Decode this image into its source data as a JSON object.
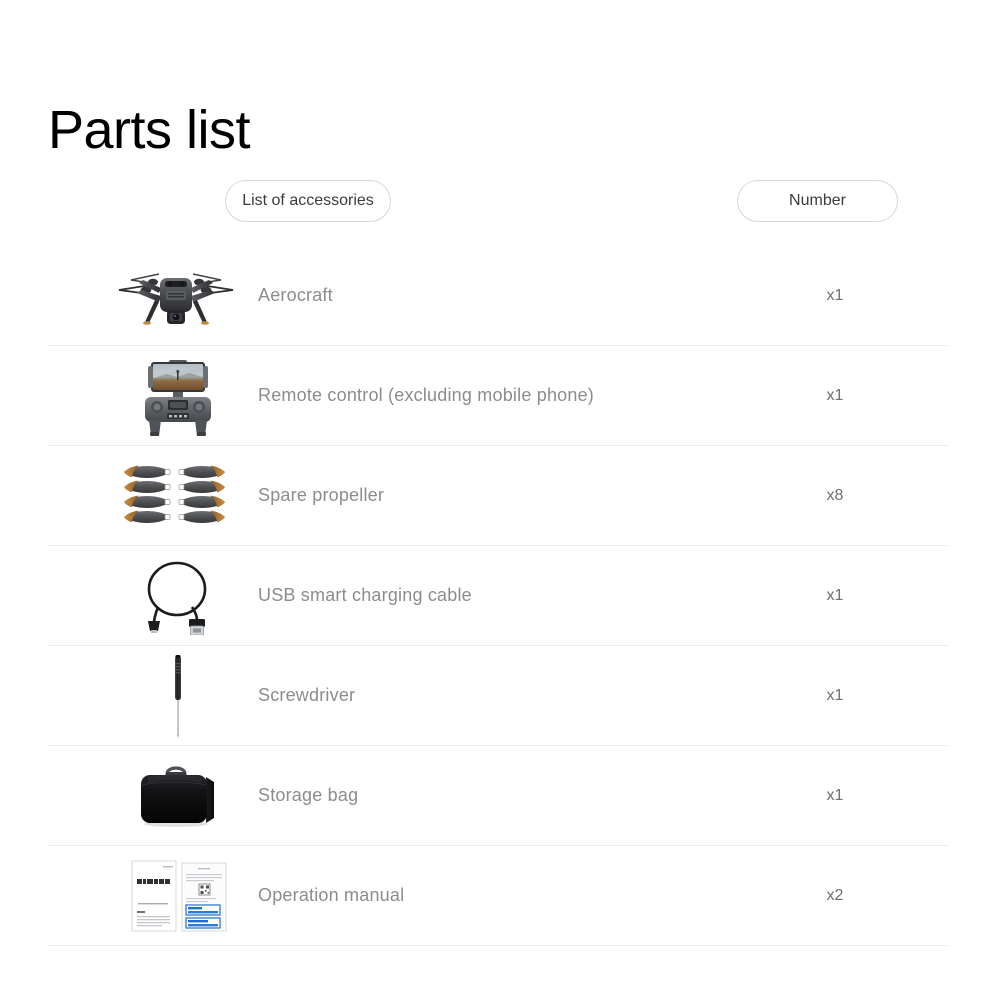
{
  "page": {
    "title": "Parts list",
    "background_color": "#ffffff",
    "title_color": "#000000",
    "label_color": "#8c8c8c",
    "divider_color": "#ececec",
    "pill_border_color": "#d8d8d8"
  },
  "header": {
    "accessories_label": "List of accessories",
    "number_label": "Number"
  },
  "rows": [
    {
      "label": "Aerocraft",
      "quantity": "x1",
      "icon": "drone-icon"
    },
    {
      "label": "Remote control (excluding mobile phone)",
      "quantity": "x1",
      "icon": "remote-control-icon"
    },
    {
      "label": "Spare propeller",
      "quantity": "x8",
      "icon": "propeller-icon"
    },
    {
      "label": "USB smart charging cable",
      "quantity": "x1",
      "icon": "usb-cable-icon"
    },
    {
      "label": "Screwdriver",
      "quantity": "x1",
      "icon": "screwdriver-icon"
    },
    {
      "label": "Storage bag",
      "quantity": "x1",
      "icon": "storage-bag-icon"
    },
    {
      "label": "Operation manual",
      "quantity": "x2",
      "icon": "manual-icon"
    }
  ]
}
